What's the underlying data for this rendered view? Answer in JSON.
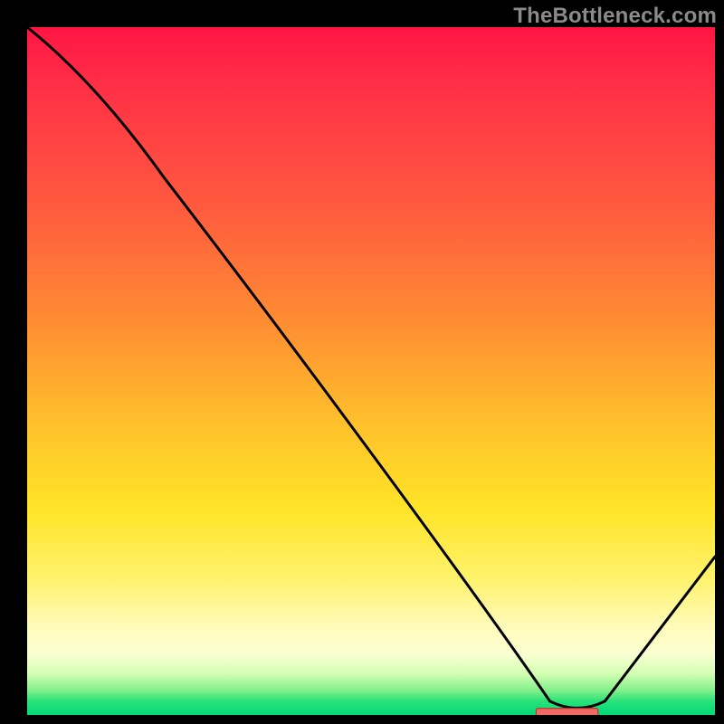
{
  "watermark": "TheBottleneck.com",
  "colors": {
    "bg": "#000000",
    "gradient_top": "#ff1544",
    "gradient_mid": "#ffe427",
    "gradient_bottom": "#00d977",
    "curve_stroke": "#000000",
    "marker_fill": "#f26a63",
    "marker_stroke": "#b03a34"
  },
  "chart_data": {
    "type": "line",
    "title": "",
    "xlabel": "",
    "ylabel": "",
    "xlim": [
      0,
      100
    ],
    "ylim": [
      0,
      100
    ],
    "x": [
      0,
      20,
      80,
      100
    ],
    "values": [
      100,
      78,
      0,
      23
    ],
    "annotations": [
      {
        "kind": "optimum-marker",
        "x_range": [
          74,
          83
        ],
        "y": 0.3
      }
    ],
    "notes": "Gradient background encodes severity (red=high at top, green=low at bottom). Black curve starts at top-left, has a slope break near x≈20, descends to a minimum near x≈80, then rises. Small red rectangle marks the optimum band near the minimum."
  }
}
